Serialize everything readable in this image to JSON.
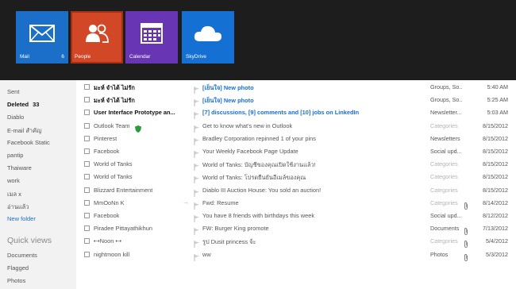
{
  "tiles": [
    {
      "label": "Mail",
      "count": "6",
      "color": "#1b6fc8",
      "icon": "mail-icon"
    },
    {
      "label": "People",
      "count": "",
      "color": "#d24726",
      "icon": "people-icon"
    },
    {
      "label": "Calendar",
      "count": "",
      "color": "#6836b4",
      "icon": "calendar-icon"
    },
    {
      "label": "SkyDrive",
      "count": "",
      "color": "#1570d3",
      "icon": "cloud-icon"
    }
  ],
  "sidebar": {
    "folders": [
      {
        "label": "Sent",
        "count": ""
      },
      {
        "label": "Deleted",
        "count": "33"
      },
      {
        "label": "Diablo",
        "count": ""
      },
      {
        "label": "E-mail สำคัญ",
        "count": ""
      },
      {
        "label": "Facebook Static",
        "count": ""
      },
      {
        "label": "pantip",
        "count": ""
      },
      {
        "label": "Thaiware",
        "count": ""
      },
      {
        "label": "work",
        "count": ""
      },
      {
        "label": "เมล x",
        "count": ""
      },
      {
        "label": "อ่านแล้ว",
        "count": ""
      }
    ],
    "new_folder": "New folder",
    "quick_views_heading": "Quick views",
    "quick_views": [
      "Documents",
      "Flagged",
      "Photos"
    ]
  },
  "messages": [
    {
      "from": "มะห์ จำได้ ไม่รัก",
      "subject": "[เย็นใจ] New photo",
      "folder": "Groups, So...",
      "date": "5:40 AM",
      "unread": true,
      "attach": false
    },
    {
      "from": "มะห์ จำได้ ไม่รัก",
      "subject": "[เย็นใจ] New photo",
      "folder": "Groups, So...",
      "date": "5:25 AM",
      "unread": true,
      "attach": false
    },
    {
      "from": "User Interface Prototype an...",
      "subject": "[7] discussions, [9] comments and [10] jobs on LinkedIn",
      "folder": "Newsletter...",
      "date": "5:03 AM",
      "unread": true,
      "attach": false
    },
    {
      "from": "Outlook Team",
      "subject": "Get to know what's new in Outlook",
      "folder": "Categories",
      "date": "8/15/2012",
      "unread": false,
      "attach": false,
      "shield": true
    },
    {
      "from": "Pinterest",
      "subject": "Bradley Corporation repinned 1 of your pins",
      "folder": "Newsletters",
      "date": "8/15/2012",
      "unread": false,
      "attach": false
    },
    {
      "from": "Facebook",
      "subject": "Your Weekly Facebook Page Update",
      "folder": "Social upd...",
      "date": "8/15/2012",
      "unread": false,
      "attach": false
    },
    {
      "from": "World of Tanks",
      "subject": "World of Tanks: บัญชีของคุณเปิดใช้งานแล้ว!",
      "folder": "Categories",
      "date": "8/15/2012",
      "unread": false,
      "attach": false
    },
    {
      "from": "World of Tanks",
      "subject": "World of Tanks: โปรดยืนยันอีเมล์ของคุณ",
      "folder": "Categories",
      "date": "8/15/2012",
      "unread": false,
      "attach": false
    },
    {
      "from": "Blizzard Entertainment",
      "subject": "Diablo III Auction House: You sold an auction!",
      "folder": "Categories",
      "date": "8/15/2012",
      "unread": false,
      "attach": false
    },
    {
      "from": "MmOoNn K",
      "subject": "Fwd: Resume",
      "folder": "Categories",
      "date": "8/14/2012",
      "unread": false,
      "attach": true,
      "forwarded": true
    },
    {
      "from": "Facebook",
      "subject": "You have 8 friends with birthdays this week",
      "folder": "Social upd...",
      "date": "8/12/2012",
      "unread": false,
      "attach": false
    },
    {
      "from": "Piradee Pittayathikhun",
      "subject": "FW: Burger King promote",
      "folder": "Documents",
      "date": "7/13/2012",
      "unread": false,
      "attach": true
    },
    {
      "from": "•-•Noon •-•",
      "subject": "รูป Dusit princess จ้ะ",
      "folder": "Categories",
      "date": "5/4/2012",
      "unread": false,
      "attach": true
    },
    {
      "from": "nightmoon kill",
      "subject": "ww",
      "folder": "Photos",
      "date": "5/3/2012",
      "unread": false,
      "attach": true
    }
  ],
  "colors": {
    "topbar": "#1d1d1d",
    "accent_link": "#1a6fd0",
    "sidebar_bg": "#f2f2f2",
    "shield": "#2a9d3a"
  }
}
